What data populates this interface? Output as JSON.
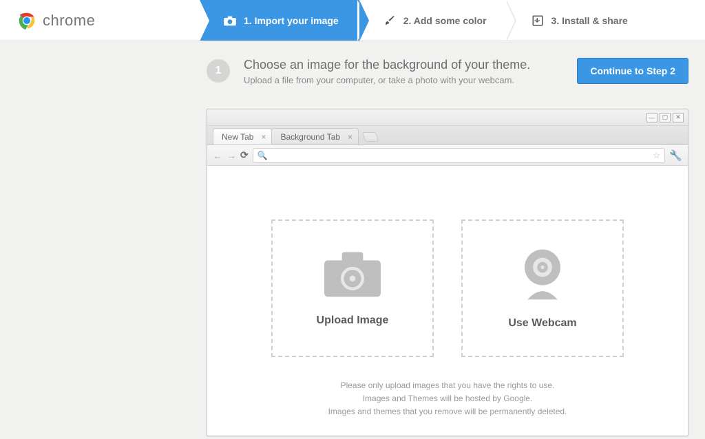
{
  "brand": {
    "name": "chrome"
  },
  "steps": [
    {
      "icon": "camera",
      "label": "1. Import your image",
      "active": true
    },
    {
      "icon": "brush",
      "label": "2. Add some color",
      "active": false
    },
    {
      "icon": "install",
      "label": "3. Install & share",
      "active": false
    }
  ],
  "instruction": {
    "badge": "1",
    "title": "Choose an image for the background of your theme.",
    "subtitle": "Upload a file from your computer, or take a photo with your webcam.",
    "continue_label": "Continue to Step 2"
  },
  "browser": {
    "tabs": [
      {
        "label": "New Tab",
        "active": true
      },
      {
        "label": "Background Tab",
        "active": false
      }
    ]
  },
  "dropzones": {
    "upload_label": "Upload Image",
    "webcam_label": "Use Webcam"
  },
  "notes": {
    "line1": "Please only upload images that you have the rights to use.",
    "line2": "Images and Themes will be hosted by Google.",
    "line3": "Images and themes that you remove will be permanently deleted."
  }
}
